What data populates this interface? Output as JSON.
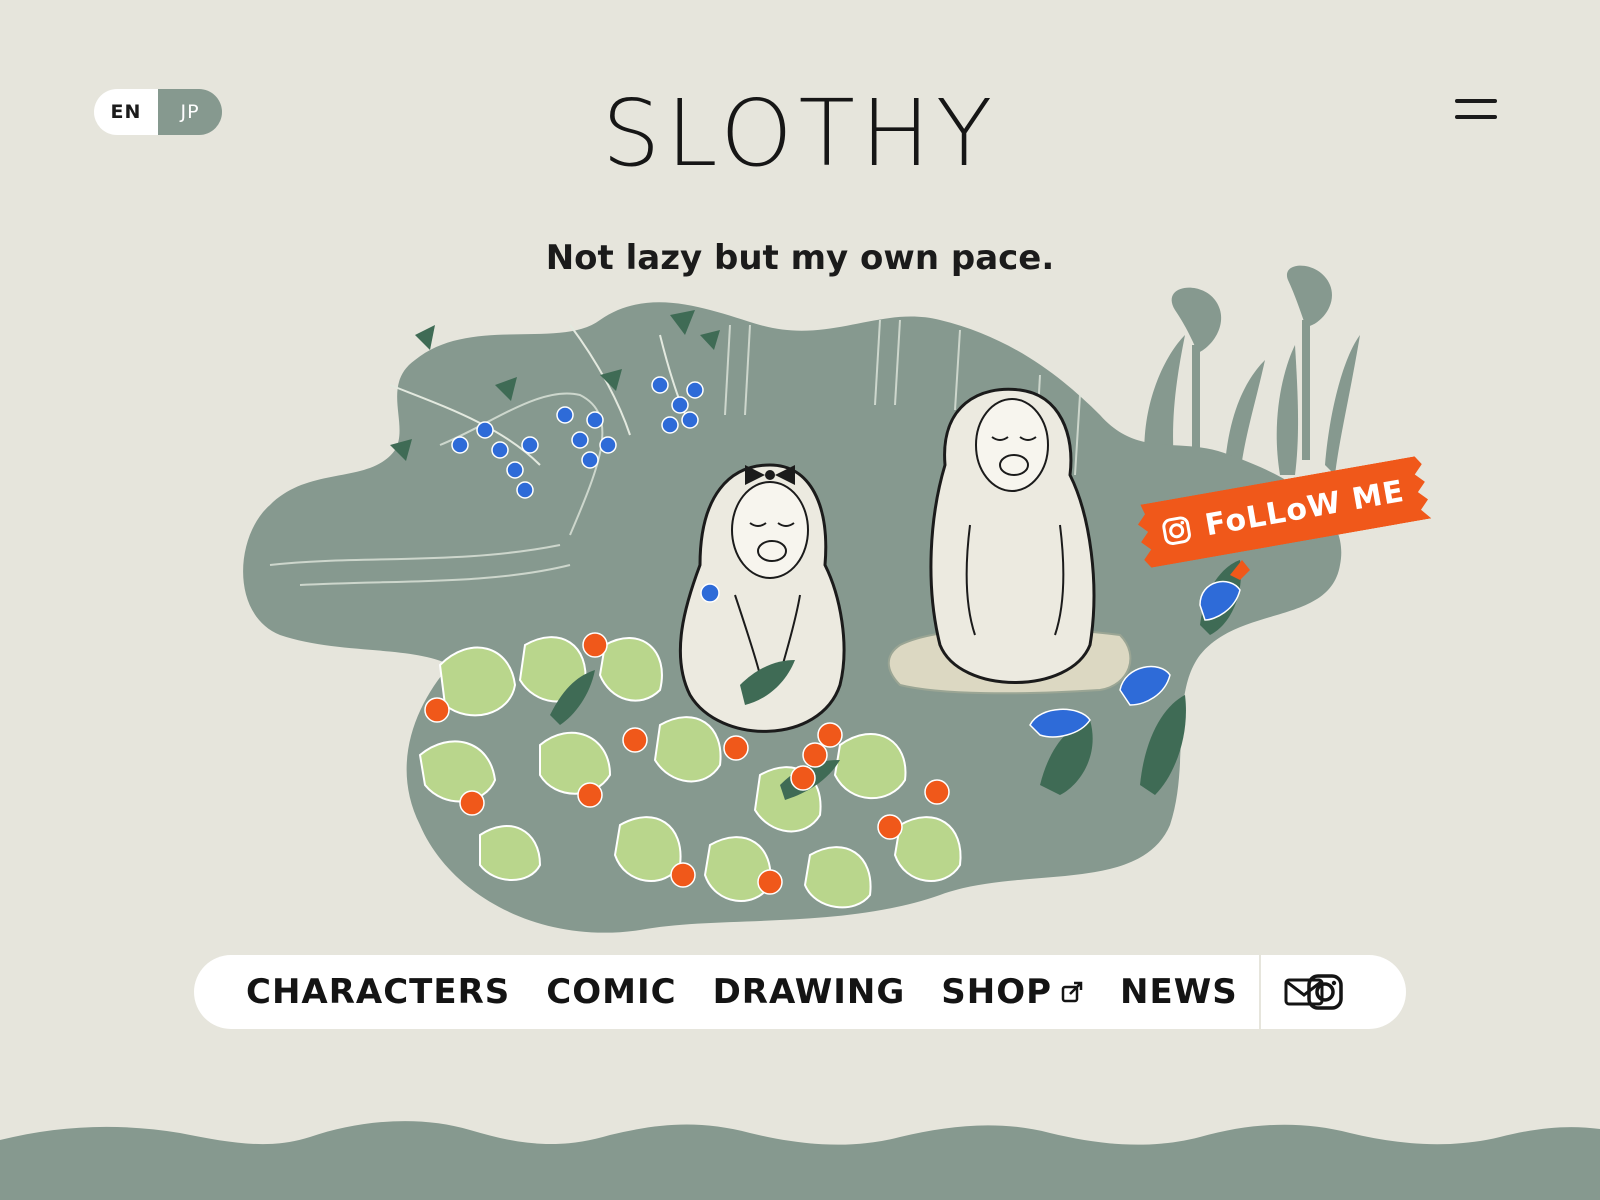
{
  "language": {
    "options": [
      {
        "code": "en",
        "label": "EN",
        "active": true
      },
      {
        "code": "jp",
        "label": "JP",
        "active": false
      }
    ]
  },
  "header": {
    "logo_text": "SLOTHY",
    "tagline": "Not lazy but my own pace.",
    "menu_icon": "hamburger-menu-icon"
  },
  "follow_badge": {
    "label": "FoLLoW ME",
    "icon": "instagram-icon",
    "color": "#f0581a"
  },
  "nav": {
    "items": [
      {
        "label": "CHARACTERS",
        "external": false
      },
      {
        "label": "COMIC",
        "external": false
      },
      {
        "label": "DRAWING",
        "external": false
      },
      {
        "label": "SHOP",
        "external": true
      },
      {
        "label": "NEWS",
        "external": false
      }
    ],
    "mail_icon": "mail-icon",
    "instagram_icon": "instagram-icon"
  },
  "colors": {
    "background": "#e6e5dc",
    "sage": "#86998f",
    "accent_orange": "#f0581a",
    "berry_blue": "#2e6bd8",
    "leaf_green": "#b9d68c",
    "text": "#1b1b1b"
  }
}
